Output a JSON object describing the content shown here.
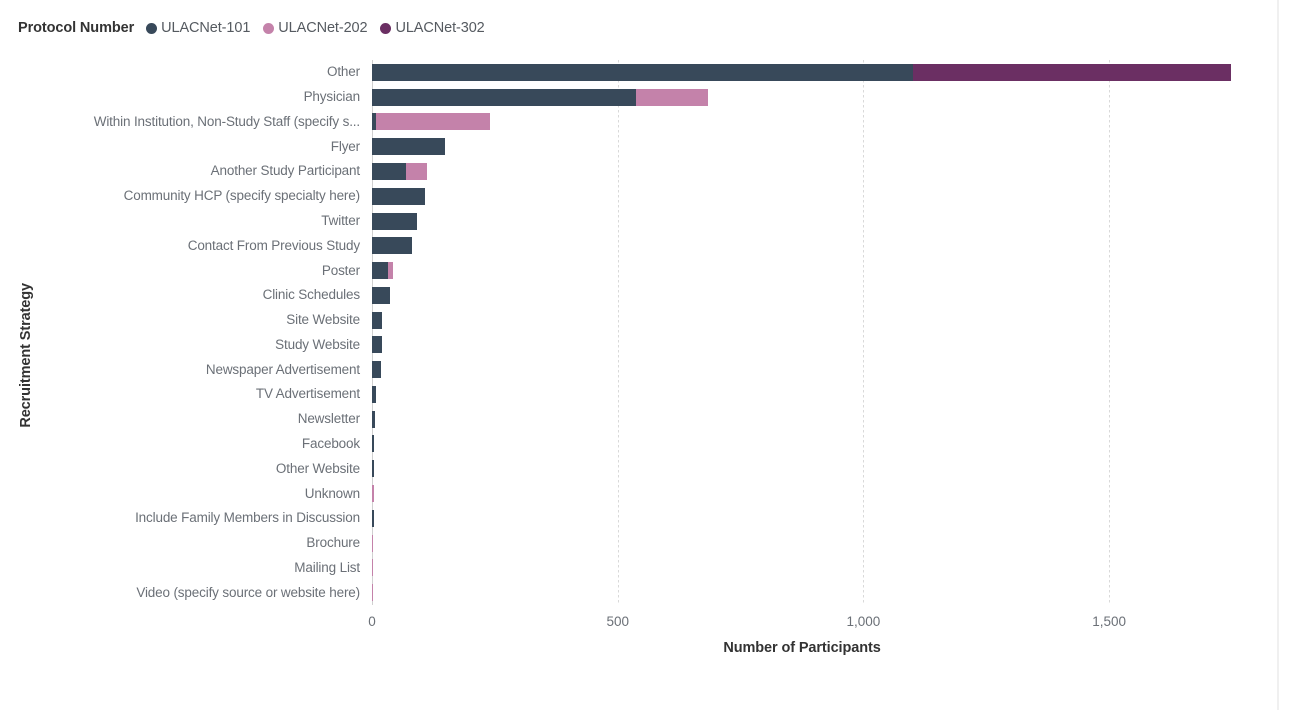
{
  "legend": {
    "title": "Protocol Number",
    "items": [
      {
        "label": "ULACNet-101",
        "color": "#38495a"
      },
      {
        "label": "ULACNet-202",
        "color": "#c482aa"
      },
      {
        "label": "ULACNet-302",
        "color": "#6b2f63"
      }
    ]
  },
  "axes": {
    "x_title": "Number of Participants",
    "y_title": "Recruitment Strategy",
    "x_ticks": [
      "0",
      "500",
      "1,000",
      "1,500"
    ]
  },
  "chart_data": {
    "type": "bar",
    "orientation": "horizontal",
    "stacked": true,
    "title": "",
    "xlabel": "Number of Participants",
    "ylabel": "Recruitment Strategy",
    "xlim": [
      0,
      1750
    ],
    "x_ticks": [
      0,
      500,
      1000,
      1500
    ],
    "x_tick_labels": [
      "0",
      "500",
      "1,000",
      "1,500"
    ],
    "grid": true,
    "legend_position": "top-left",
    "legend_title": "Protocol Number",
    "categories": [
      "Other",
      "Physician",
      "Within Institution, Non-Study Staff (specify s...",
      "Flyer",
      "Another Study Participant",
      "Community HCP (specify specialty here)",
      "Twitter",
      "Contact From Previous Study",
      "Poster",
      "Clinic Schedules",
      "Site Website",
      "Study Website",
      "Newspaper Advertisement",
      "TV Advertisement",
      "Newsletter",
      "Facebook",
      "Other Website",
      "Unknown",
      "Include Family Members in Discussion",
      "Brochure",
      "Mailing List",
      "Video (specify source or website here)"
    ],
    "series": [
      {
        "name": "ULACNet-101",
        "color": "#38495a",
        "values": [
          1100,
          537,
          8,
          148,
          70,
          108,
          92,
          82,
          32,
          37,
          21,
          20,
          19,
          8,
          7,
          5,
          5,
          0,
          4,
          0,
          0,
          0
        ]
      },
      {
        "name": "ULACNet-202",
        "color": "#c482aa",
        "values": [
          0,
          146,
          232,
          0,
          42,
          0,
          0,
          0,
          11,
          0,
          0,
          0,
          0,
          0,
          0,
          0,
          0,
          4,
          0,
          2,
          1,
          1
        ]
      },
      {
        "name": "ULACNet-302",
        "color": "#6b2f63",
        "values": [
          648,
          0,
          0,
          0,
          0,
          0,
          0,
          0,
          0,
          0,
          0,
          0,
          0,
          0,
          0,
          0,
          0,
          0,
          0,
          0,
          0,
          0
        ]
      }
    ],
    "totals": [
      1748,
      683,
      240,
      148,
      112,
      108,
      92,
      82,
      43,
      37,
      21,
      20,
      19,
      8,
      7,
      5,
      5,
      4,
      4,
      2,
      1,
      1
    ]
  }
}
